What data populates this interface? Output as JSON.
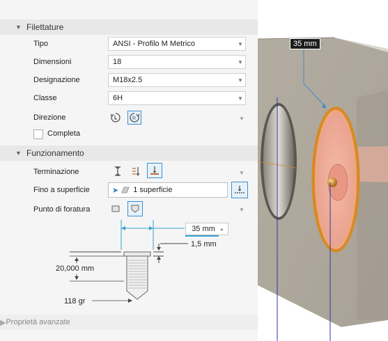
{
  "sections": {
    "threads": "Filettature",
    "operation": "Funzionamento",
    "advanced": "Proprietà avanzate"
  },
  "fields": {
    "tipo": {
      "label": "Tipo",
      "value": "ANSI - Profilo M Metrico"
    },
    "dimensioni": {
      "label": "Dimensioni",
      "value": "18"
    },
    "designazione": {
      "label": "Designazione",
      "value": "M18x2.5"
    },
    "classe": {
      "label": "Classe",
      "value": "6H"
    },
    "direzione": {
      "label": "Direzione"
    },
    "completa": {
      "label": "Completa"
    },
    "terminazione": {
      "label": "Terminazione"
    },
    "fino": {
      "label": "Fino a superficie",
      "value": "1 superficie"
    },
    "punto": {
      "label": "Punto di foratura"
    }
  },
  "diagram": {
    "width": "35 mm",
    "offset": "1,5 mm",
    "depth": "20,000 mm",
    "angle": "118 gr"
  },
  "viewport": {
    "dimension": "35 mm"
  },
  "colors": {
    "accent": "#3b8fd1",
    "ring": "#d98a1e"
  }
}
